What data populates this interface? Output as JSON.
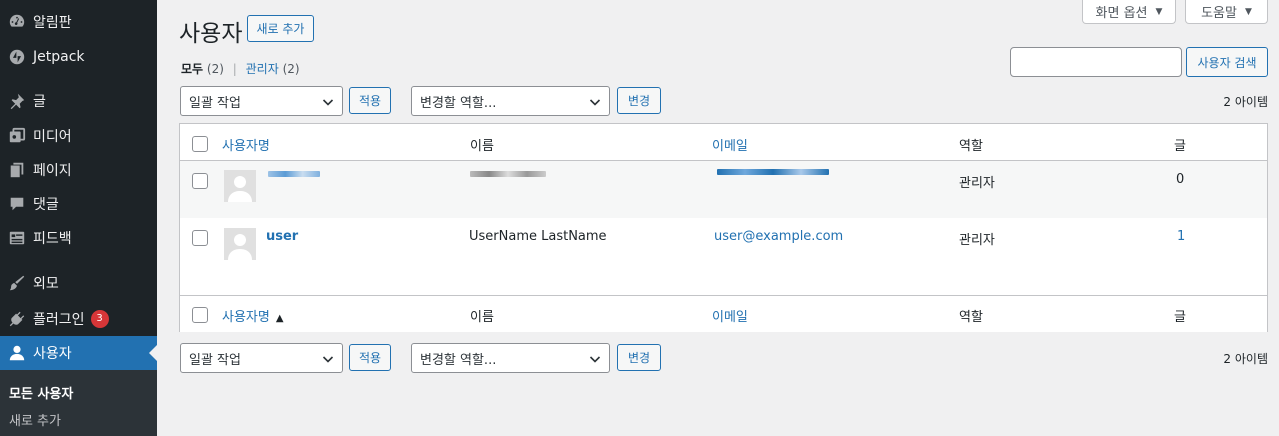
{
  "sidebar": {
    "items": [
      {
        "label": "알림판",
        "icon": "dashboard-icon"
      },
      {
        "label": "Jetpack",
        "icon": "jetpack-icon"
      },
      {
        "label": "글",
        "icon": "pin-icon"
      },
      {
        "label": "미디어",
        "icon": "media-icon"
      },
      {
        "label": "페이지",
        "icon": "page-icon"
      },
      {
        "label": "댓글",
        "icon": "comment-icon"
      },
      {
        "label": "피드백",
        "icon": "feedback-icon"
      },
      {
        "label": "외모",
        "icon": "appearance-brush-icon"
      },
      {
        "label": "플러그인",
        "icon": "plugin-icon",
        "badge": "3"
      },
      {
        "label": "사용자",
        "icon": "user-icon",
        "active": true
      }
    ],
    "submenu": [
      {
        "label": "모든 사용자",
        "current": true
      },
      {
        "label": "새로 추가"
      }
    ]
  },
  "screen_meta": {
    "screen_options": "화면 옵션",
    "help": "도움말"
  },
  "header": {
    "title": "사용자",
    "add_new": "새로 추가"
  },
  "filters": {
    "all_label": "모두",
    "all_count": "(2)",
    "separator": "|",
    "admin_label": "관리자",
    "admin_count": "(2)"
  },
  "search": {
    "placeholder": "",
    "button": "사용자 검색"
  },
  "bulk_top": {
    "bulk_action": "일괄 작업",
    "apply": "적용",
    "change_role": "변경할 역할...",
    "change": "변경",
    "items_count": "2 아이템"
  },
  "bulk_bottom": {
    "bulk_action": "일괄 작업",
    "apply": "적용",
    "change_role": "변경할 역할...",
    "change": "변경",
    "items_count": "2 아이템"
  },
  "table": {
    "columns": {
      "username": "사용자명",
      "name": "이름",
      "email": "이메일",
      "role": "역할",
      "posts": "글"
    },
    "rows": [
      {
        "username": "",
        "name": "",
        "email": "",
        "role": "관리자",
        "posts": "0",
        "redacted": true
      },
      {
        "username": "user",
        "name": "UserName LastName",
        "email": "user@example.com",
        "role": "관리자",
        "posts": "1",
        "redacted": false
      }
    ],
    "footer_sort_indicator": "▲"
  },
  "colors": {
    "sidebar_bg": "#1d2327",
    "accent": "#2271b1",
    "badge": "#d63638",
    "page_bg": "#f0f0f1"
  }
}
